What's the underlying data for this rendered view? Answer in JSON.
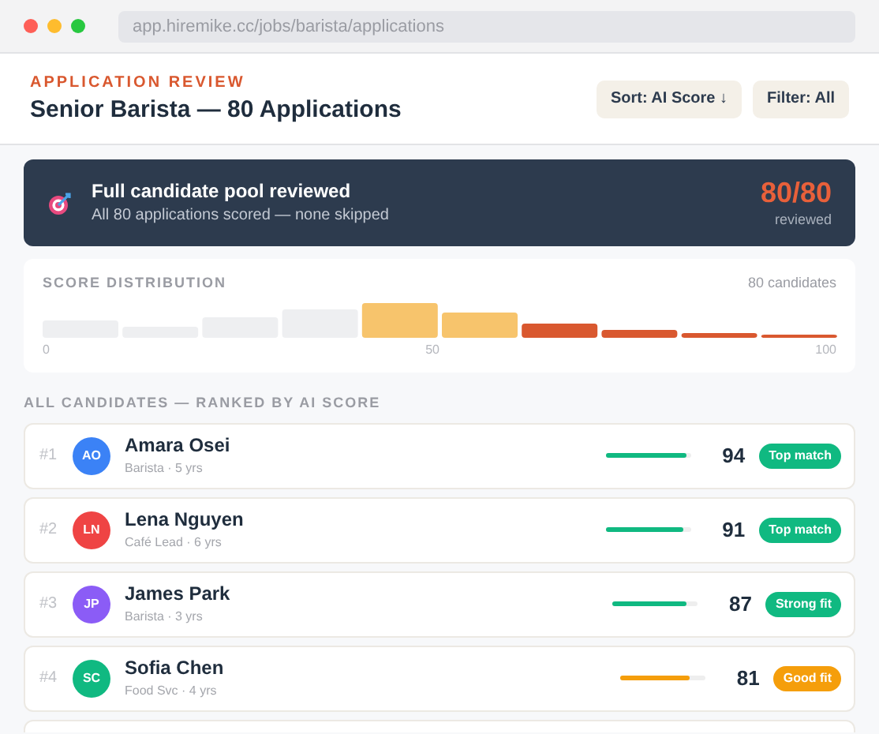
{
  "browser": {
    "url": "app.hiremike.cc/jobs/barista/applications"
  },
  "header": {
    "eyebrow": "APPLICATION REVIEW",
    "title": "Senior Barista — 80 Applications",
    "buttons": [
      "Sort: AI Score ↓",
      "Filter: All"
    ]
  },
  "banner": {
    "title": "Full candidate pool reviewed",
    "subtitle": "All 80 applications scored — none skipped",
    "count": "80/80",
    "count_label": "reviewed"
  },
  "distribution": {
    "title": "SCORE DISTRIBUTION",
    "total": "80 candidates",
    "axis_labels": [
      "0",
      "50",
      "100"
    ]
  },
  "section_label": "ALL CANDIDATES — RANKED BY AI SCORE",
  "candidates": [
    {
      "rank": "#1",
      "initials": "AO",
      "color": "#3b82f6",
      "name": "Amara Osei",
      "meta": "Barista · 5 yrs",
      "level": 0.94,
      "score": "94",
      "badge": "Top match",
      "kind": "top"
    },
    {
      "rank": "#2",
      "initials": "LN",
      "color": "#ef4444",
      "name": "Lena Nguyen",
      "meta": "Café Lead · 6 yrs",
      "level": 0.91,
      "score": "91",
      "badge": "Top match",
      "kind": "top"
    },
    {
      "rank": "#3",
      "initials": "JP",
      "color": "#8b5cf6",
      "name": "James Park",
      "meta": "Barista · 3 yrs",
      "level": 0.87,
      "score": "87",
      "badge": "Strong fit",
      "kind": "strong"
    },
    {
      "rank": "#4",
      "initials": "SC",
      "color": "#10b981",
      "name": "Sofia Chen",
      "meta": "Food Svc · 4 yrs",
      "level": 0.81,
      "score": "81",
      "badge": "Good fit",
      "kind": "good"
    }
  ]
}
